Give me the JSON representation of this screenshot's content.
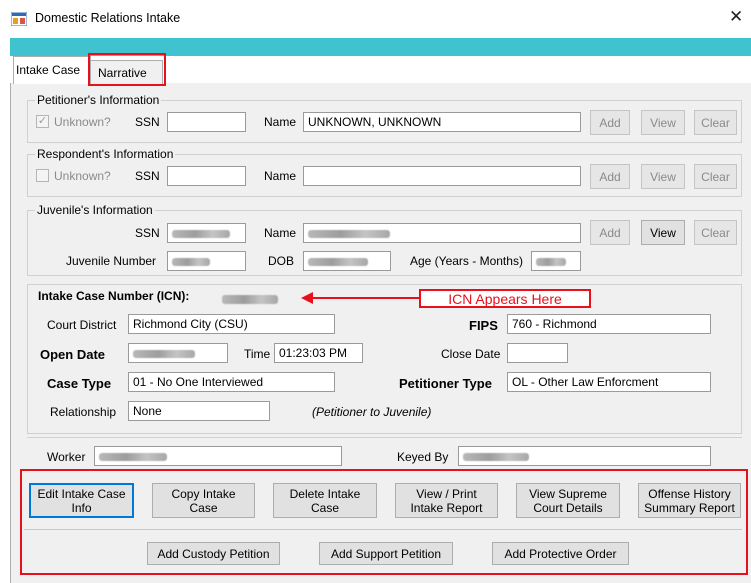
{
  "window": {
    "title": "Domestic Relations Intake"
  },
  "tabs": [
    {
      "label": "Intake Case"
    },
    {
      "label": "Narrative"
    }
  ],
  "petitioner": {
    "section_title": "Petitioner's Information",
    "unknown_label": "Unknown?",
    "unknown_checked": true,
    "ssn_label": "SSN",
    "ssn_value": "",
    "name_label": "Name",
    "name_value": "UNKNOWN, UNKNOWN",
    "add_label": "Add",
    "view_label": "View",
    "clear_label": "Clear"
  },
  "respondent": {
    "section_title": "Respondent's Information",
    "unknown_label": "Unknown?",
    "unknown_checked": false,
    "ssn_label": "SSN",
    "ssn_value": "",
    "name_label": "Name",
    "name_value": "",
    "add_label": "Add",
    "view_label": "View",
    "clear_label": "Clear"
  },
  "juvenile": {
    "section_title": "Juvenile's Information",
    "ssn_label": "SSN",
    "name_label": "Name",
    "juvenile_number_label": "Juvenile Number",
    "dob_label": "DOB",
    "age_label": "Age (Years - Months)",
    "add_label": "Add",
    "view_label": "View",
    "clear_label": "Clear"
  },
  "intake": {
    "icn_label": "Intake Case Number (ICN):",
    "court_district_label": "Court District",
    "court_district_value": "Richmond City (CSU)",
    "fips_label": "FIPS",
    "fips_value": "760 - Richmond",
    "open_date_label": "Open Date",
    "time_label": "Time",
    "time_value": "01:23:03 PM",
    "close_date_label": "Close Date",
    "close_date_value": "",
    "case_type_label": "Case Type",
    "case_type_value": "01 - No One Interviewed",
    "petitioner_type_label": "Petitioner Type",
    "petitioner_type_value": "OL - Other Law Enforcment",
    "relationship_label": "Relationship",
    "relationship_value": "None",
    "relationship_note": "(Petitioner to Juvenile)",
    "worker_label": "Worker",
    "keyed_by_label": "Keyed By"
  },
  "callout": {
    "text": "ICN Appears Here",
    "color": "#e8101b"
  },
  "actions": {
    "row1": [
      {
        "line1": "Edit Intake Case",
        "line2": "Info"
      },
      {
        "line1": "Copy Intake",
        "line2": "Case"
      },
      {
        "line1": "Delete Intake",
        "line2": "Case"
      },
      {
        "line1": "View / Print",
        "line2": "Intake Report"
      },
      {
        "line1": "View Supreme",
        "line2": "Court Details"
      },
      {
        "line1": "Offense History",
        "line2": "Summary Report"
      }
    ],
    "row2": [
      {
        "label": "Add Custody Petition"
      },
      {
        "label": "Add Support Petition"
      },
      {
        "label": "Add Protective Order"
      }
    ]
  },
  "colors": {
    "accent_band": "#3ec3cf",
    "highlight": "#e8101b",
    "focus": "#0078d7"
  }
}
